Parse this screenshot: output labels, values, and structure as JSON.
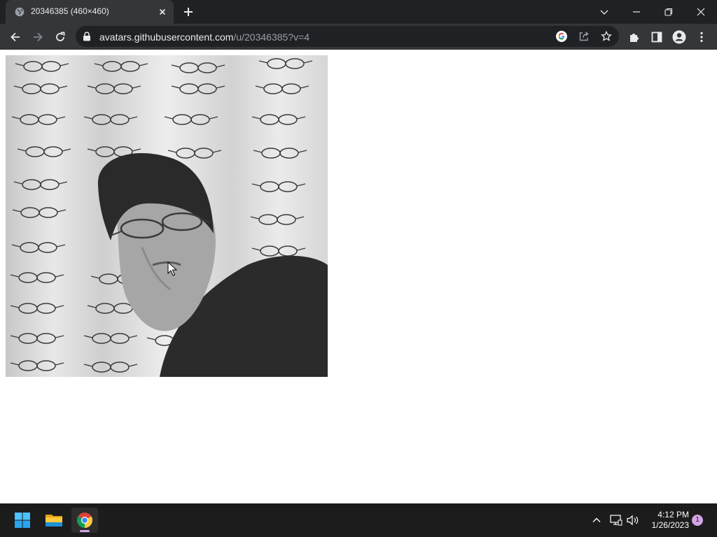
{
  "browser": {
    "tab": {
      "title": "20346385 (460×460)",
      "favicon": "globe-icon"
    },
    "window_controls": [
      "chevron-down-icon",
      "minimize-icon",
      "restore-icon",
      "close-icon"
    ],
    "address_bar": {
      "host": "avatars.githubusercontent.com",
      "path": "/u/20346385?v=4"
    },
    "toolbar_icons": [
      "back-icon",
      "forward-icon",
      "reload-icon",
      "lock-icon",
      "google-icon",
      "share-icon",
      "star-icon",
      "extensions-icon",
      "side-panel-icon",
      "profile-icon",
      "menu-icon"
    ]
  },
  "page": {
    "image": {
      "description_icon": "avatar-photo",
      "tone": "grayscale"
    }
  },
  "taskbar": {
    "apps": [
      "windows-start-icon",
      "file-explorer-icon",
      "chrome-icon"
    ],
    "tray": [
      "chevron-up-icon",
      "network-icon",
      "volume-icon"
    ],
    "time": "4:12 PM",
    "date": "1/26/2023",
    "notification_count": "1"
  },
  "colors": {
    "tabstrip": "#202124",
    "toolbar": "#35363a",
    "omnibox": "#202124",
    "taskbar": "#1c1c1c",
    "accent": "#d3a4e6"
  }
}
